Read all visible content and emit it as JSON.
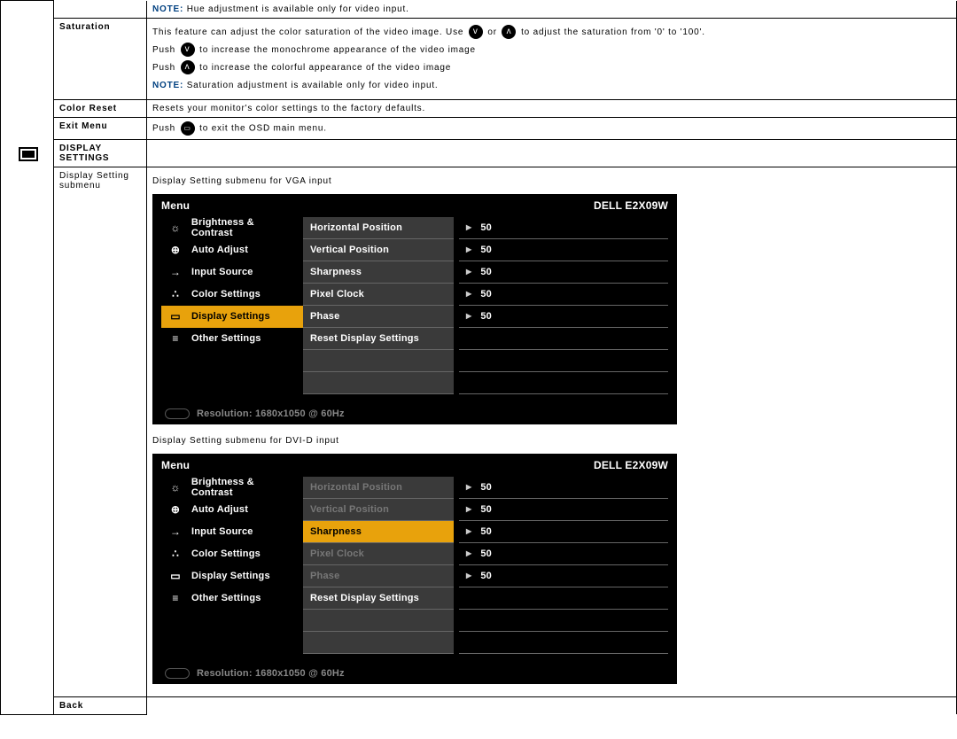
{
  "notes": {
    "hue": "NOTE:",
    "hue_text": " Hue adjustment is available only for video input.",
    "sat": "NOTE:",
    "sat_text": " Saturation adjustment is available only for video input."
  },
  "rows": {
    "saturation_label": "Saturation",
    "saturation_p1a": "This feature can adjust the color saturation of the video image. Use ",
    "saturation_p1b": " or ",
    "saturation_p1c": " to adjust the saturation from '0' to '100'.",
    "saturation_p2a": "Push ",
    "saturation_p2b": " to increase the monochrome appearance of the video image",
    "saturation_p3a": "Push ",
    "saturation_p3b": " to increase the colorful appearance of the video image",
    "colorreset_label": "Color Reset",
    "colorreset_text": "Resets your monitor's color settings to the factory defaults.",
    "exitmenu_label": "Exit Menu",
    "exitmenu_a": "Push ",
    "exitmenu_b": " to exit the OSD main menu.",
    "displaysettings_label": "DISPLAY SETTINGS",
    "displaysub_label": "Display Setting submenu",
    "vga_caption": "Display Setting  submenu for VGA input",
    "dvi_caption": "Display Setting  submenu for DVI-D input",
    "back_label": "Back"
  },
  "osd_common": {
    "menu_label": "Menu",
    "brand": "DELL E2X09W",
    "resolution": "Resolution: 1680x1050 @ 60Hz",
    "left_items": [
      {
        "icon": "☼",
        "label": "Brightness & Contrast"
      },
      {
        "icon": "⊕",
        "label": "Auto Adjust"
      },
      {
        "icon": "→",
        "label": "Input Source"
      },
      {
        "icon": "∴",
        "label": "Color Settings"
      },
      {
        "icon": "▭",
        "label": "Display Settings"
      },
      {
        "icon": "≡",
        "label": "Other Settings"
      }
    ],
    "mid_items": [
      "Horizontal Position",
      "Vertical Position",
      "Sharpness",
      "Pixel Clock",
      "Phase",
      "Reset Display Settings"
    ],
    "values": [
      "50",
      "50",
      "50",
      "50",
      "50"
    ]
  },
  "osd_vga": {
    "selected_left_index": 4,
    "selected_mid_index": -1,
    "dim_mid": []
  },
  "osd_dvi": {
    "selected_left_index": -1,
    "selected_mid_index": 2,
    "dim_mid": [
      0,
      1,
      3,
      4
    ]
  }
}
